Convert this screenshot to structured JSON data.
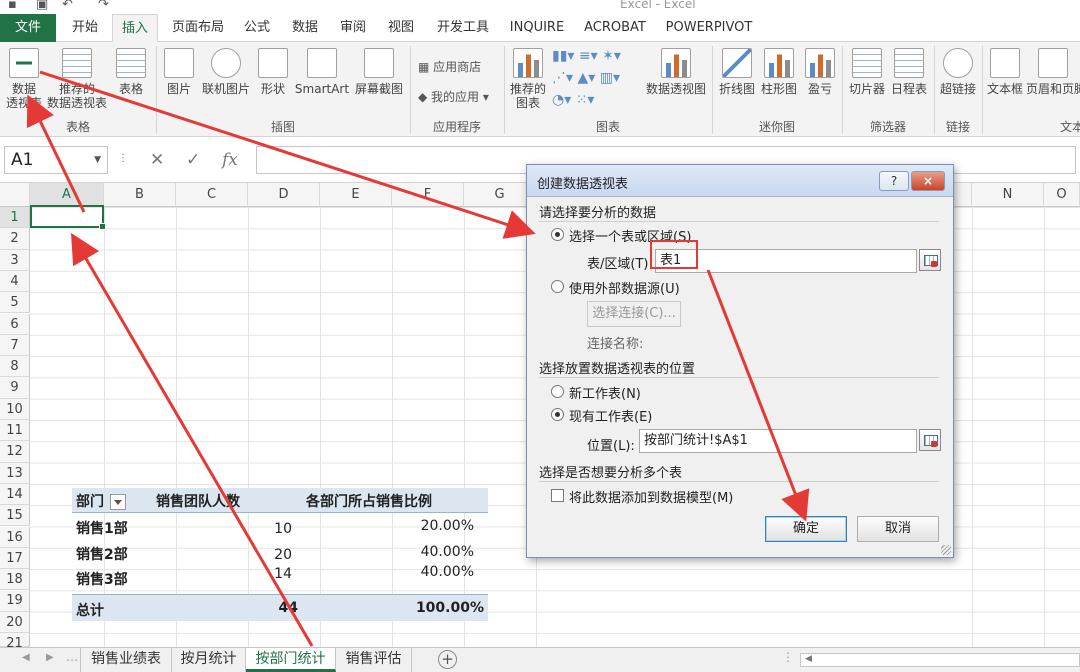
{
  "window": {
    "title": "Excel - Excel"
  },
  "tabs": [
    {
      "label": "文件"
    },
    {
      "label": "开始"
    },
    {
      "label": "插入"
    },
    {
      "label": "页面布局"
    },
    {
      "label": "公式"
    },
    {
      "label": "数据"
    },
    {
      "label": "审阅"
    },
    {
      "label": "视图"
    },
    {
      "label": "开发工具"
    },
    {
      "label": "INQUIRE"
    },
    {
      "label": "ACROBAT"
    },
    {
      "label": "POWERPIVOT"
    }
  ],
  "ribbon": {
    "pivot_label": "数据\n透视表",
    "recommended_pivot_label": "推荐的\n数据透视表",
    "table_label": "表格",
    "group_tables": "表格",
    "picture_label": "图片",
    "online_picture_label": "联机图片",
    "shapes_label": "形状",
    "smartart_label": "SmartArt",
    "screenshot_label": "屏幕截图",
    "group_illustrations": "插图",
    "app_store_label": "应用商店",
    "my_apps_label": "我的应用",
    "group_apps": "应用程序",
    "recommended_charts_label": "推荐的\n图表",
    "pivot_chart_label": "数据透视图",
    "group_charts": "图表",
    "line_spark_label": "折线图",
    "column_spark_label": "柱形图",
    "winloss_label": "盈亏",
    "group_sparklines": "迷你图",
    "slicer_label": "切片器",
    "timeline_label": "日程表",
    "group_filters": "筛选器",
    "hyperlink_label": "超链接",
    "group_links": "链接",
    "textbox_label": "文本框",
    "header_footer_label": "页眉和页脚",
    "group_text": "文本"
  },
  "formula_bar": {
    "name_box": "A1",
    "fx": "fx"
  },
  "grid": {
    "columns": [
      "A",
      "B",
      "C",
      "D",
      "E",
      "F",
      "G",
      "N",
      "O"
    ],
    "rows": [
      "1",
      "2",
      "3",
      "4",
      "5",
      "6",
      "7",
      "8",
      "9",
      "10",
      "11",
      "12",
      "13",
      "14",
      "15",
      "16",
      "17",
      "18",
      "19",
      "20",
      "21"
    ]
  },
  "pivot": {
    "headers": [
      "部门",
      "销售团队人数",
      "各部门所占销售比例"
    ],
    "rows": [
      {
        "dept": "销售1部",
        "count": "10",
        "ratio": "20.00%"
      },
      {
        "dept": "销售2部",
        "count": "20",
        "ratio": "40.00%"
      },
      {
        "dept": "销售3部",
        "count": "14",
        "ratio": "40.00%"
      }
    ],
    "total": {
      "label": "总计",
      "count": "44",
      "ratio": "100.00%"
    }
  },
  "sheets": [
    {
      "label": "销售业绩表"
    },
    {
      "label": "按月统计"
    },
    {
      "label": "按部门统计"
    },
    {
      "label": "销售评估"
    }
  ],
  "dialog": {
    "title": "创建数据透视表",
    "help": "?",
    "close": "×",
    "section1": "请选择要分析的数据",
    "radio_table": "选择一个表或区域(S)",
    "range_label": "表/区域(T):",
    "range_value": "表1",
    "radio_external": "使用外部数据源(U)",
    "choose_conn": "选择连接(C)...",
    "conn_name_label": "连接名称:",
    "section2": "选择放置数据透视表的位置",
    "radio_new": "新工作表(N)",
    "radio_existing": "现有工作表(E)",
    "location_label": "位置(L):",
    "location_value": "按部门统计!$A$1",
    "section3": "选择是否想要分析多个表",
    "add_model": "将此数据添加到数据模型(M)",
    "ok": "确定",
    "cancel": "取消"
  },
  "colors": {
    "excel_green": "#217346",
    "annotation_red": "#e53935",
    "pivot_header_bg": "#dce6f1"
  }
}
